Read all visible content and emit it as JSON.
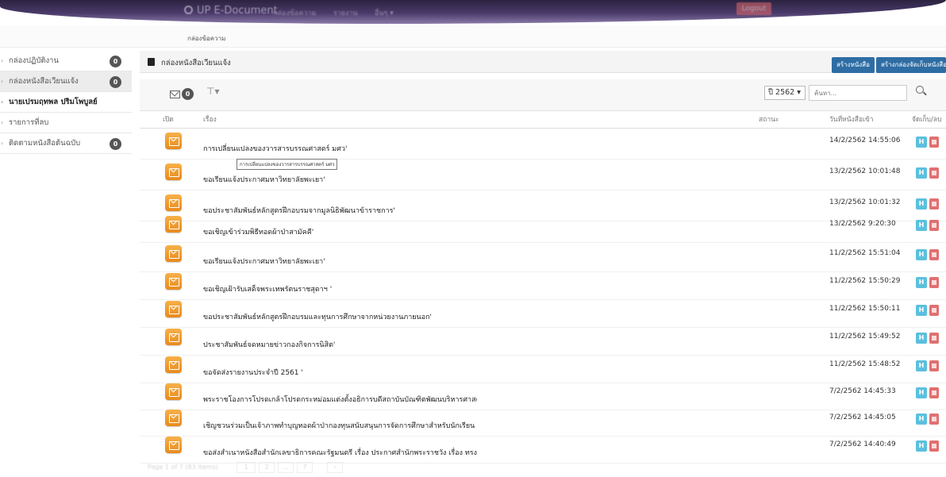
{
  "navbar": {
    "brand": "UP E-Document",
    "items": [
      "กล่องข้อความ",
      "รายงาน",
      "อื่นๆ ▾"
    ],
    "logout": "Logout"
  },
  "breadcrumb": "กล่องข้อความ",
  "sidebar": {
    "items": [
      {
        "label": "กล่องปฏิบัติงาน",
        "count": "0"
      },
      {
        "label": "กล่องหนังสือเวียนแจ้ง",
        "count": "0"
      },
      {
        "label": "นายเปรมฤทพล ปริมโพบูลย์",
        "count": ""
      },
      {
        "label": "รายการที่ลบ",
        "count": ""
      },
      {
        "label": "ติดตามหนังสือต้นฉบับ",
        "count": "0"
      }
    ]
  },
  "panel": {
    "title": "กล่องหนังสือเวียนแจ้ง",
    "create_doc": "สร้างหนังสือ",
    "create_box": "สร้างกล่องจัดเก็บหนังสือ"
  },
  "toolbar": {
    "mail_count": "0",
    "year": "ปี 2562",
    "search_placeholder": "ค้นหา..."
  },
  "table": {
    "headers": {
      "open": "เปิด",
      "subject": "เรื่อง",
      "status": "สถานะ",
      "date": "วันที่หนังสือเข้า",
      "actions": "จัดเก็บ/ลบ"
    },
    "rows": [
      {
        "subject": "การเปลี่ยนแปลงของวารสารบรรณศาสตร์ มศว'",
        "date": "14/2/2562 14:55:06"
      },
      {
        "subject": "ขอเรียนแจ้งประกาศมหาวิทยาลัยพะเยา'",
        "date": "13/2/2562 10:01:48"
      },
      {
        "subject": "ขอประชาสัมพันธ์หลักสูตรฝึกอบรมจากมูลนิธิพัฒนาข้าราชการ'",
        "date": "13/2/2562 10:01:32"
      },
      {
        "subject": "ขอเชิญเข้าร่วมพิธีทอดผ้าป่าสามัคคี'",
        "date": "13/2/2562 9:20:30"
      },
      {
        "subject": "ขอเรียนแจ้งประกาศมหาวิทยาลัยพะเยา'",
        "date": "11/2/2562 15:51:04"
      },
      {
        "subject": "ขอเชิญเฝ้ารับเสด็จพระเทพรัตนราชสุดาฯ '",
        "date": "11/2/2562 15:50:29"
      },
      {
        "subject": "ขอประชาสัมพันธ์หลักสูตรฝึกอบรมและทุนการศึกษาจากหน่วยงานภายนอก'",
        "date": "11/2/2562 15:50:11"
      },
      {
        "subject": "ประชาสัมพันธ์จดหมายข่าวกองกิจการนิสิต'",
        "date": "11/2/2562 15:49:52"
      },
      {
        "subject": "ขอจัดส่งรายงานประจำปี 2561 '",
        "date": "11/2/2562 15:48:52"
      },
      {
        "subject": "พระราชโองการโปรดเกล้าโปรดกระหม่อมแต่งตั้งอธิการบดีสถาบันบัณฑิตพัฒนบริหารศาสตร์",
        "date": "7/2/2562 14:45:33"
      },
      {
        "subject": "เชิญชวนร่วมเป็นเจ้าภาพทำบุญทอดผ้าป่ากองทุนสนับสนุนการจัดการศึกษาสำหรับนักเรียน",
        "date": "7/2/2562 14:45:05"
      },
      {
        "subject": "ขอส่งสำเนาหนังสือสำนักเลขาธิการคณะรัฐมนตรี เรื่อง ประกาศสำนักพระราชวัง เรื่อง ทรง",
        "date": "7/2/2562 14:40:49"
      }
    ],
    "action_label": "H"
  },
  "tooltip": "การเปลี่ยนแปลงของวารสารบรรณศาสตร์ มศว",
  "pager": {
    "text": "Page 1 of 7 (83 items)",
    "pages": [
      "1",
      "2",
      "...",
      "7",
      "›"
    ]
  }
}
